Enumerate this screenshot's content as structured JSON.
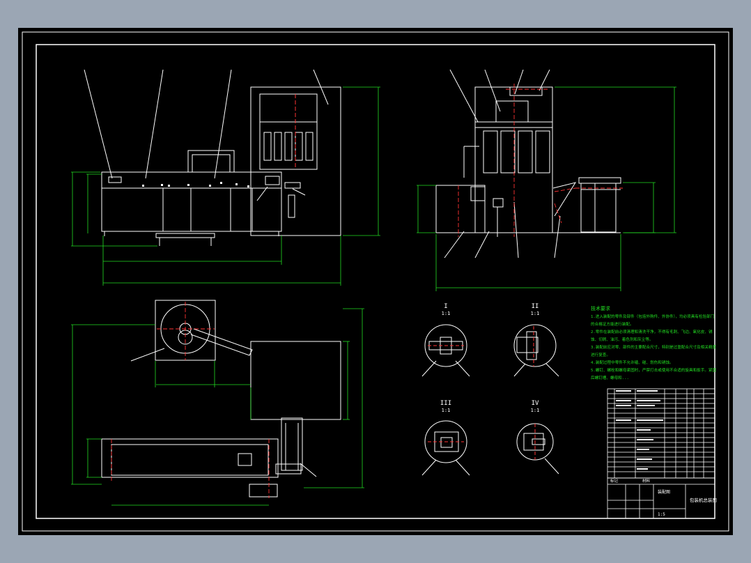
{
  "drawing": {
    "view_labels": [
      {
        "roman": "I",
        "scale": "1:1"
      },
      {
        "roman": "II",
        "scale": "1:1"
      },
      {
        "roman": "III",
        "scale": "1:1"
      },
      {
        "roman": "IV",
        "scale": "1:1"
      }
    ],
    "tech_requirements": {
      "heading": "技术要求",
      "lines": [
        "1.进入装配的零件及部件（包括外购件、外协件），均必须具有检验部门",
        "的合格证方能进行装配。",
        "2.零件在装配前必须清理和清洗干净，不得有毛刺、飞边、氧化皮、锈",
        "蚀、切屑、油污、着色剂和灰尘等。",
        "3.装配前应对零、部件的主要配合尺寸，特别是过盈配合尺寸及相关精度",
        "进行复查。",
        "4.装配过程中零件不允许磕、碰、划伤和锈蚀。",
        "5.螺钉、螺栓和螺母紧固时，严禁打击或使用不合适的旋具和扳手。紧固",
        "后螺钉槽、螺母和..."
      ]
    },
    "title_block": {
      "drawing_title": "包装机总装图",
      "small_cells": [
        "装配图",
        "1:5",
        "材料",
        "标记"
      ]
    }
  }
}
